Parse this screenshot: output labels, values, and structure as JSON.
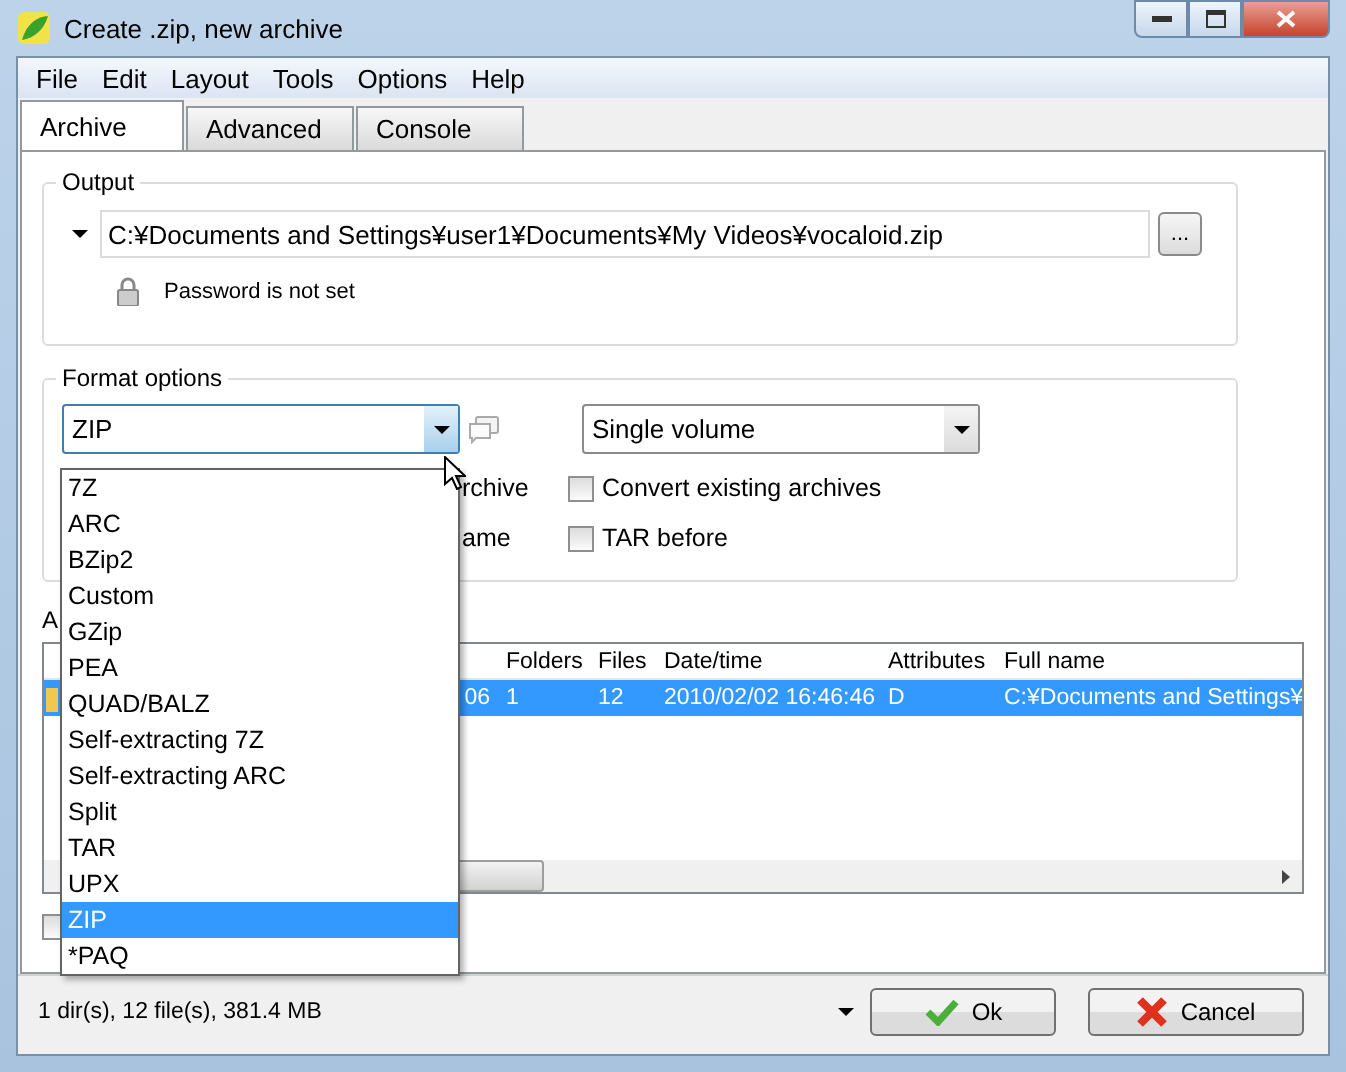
{
  "window": {
    "title": "Create .zip, new archive"
  },
  "menu": [
    "File",
    "Edit",
    "Layout",
    "Tools",
    "Options",
    "Help"
  ],
  "tabs": [
    {
      "label": "Archive",
      "selected": true
    },
    {
      "label": "Advanced",
      "selected": false
    },
    {
      "label": "Console",
      "selected": false
    }
  ],
  "output": {
    "legend": "Output",
    "path": "C:¥Documents and Settings¥user1¥Documents¥My Videos¥vocaloid.zip",
    "browse": "...",
    "password": "Password is not set"
  },
  "format_options": {
    "legend": "Format options",
    "format": {
      "value": "ZIP",
      "open": true,
      "options": [
        {
          "label": "7Z",
          "selected": false
        },
        {
          "label": "ARC",
          "selected": false
        },
        {
          "label": "BZip2",
          "selected": false
        },
        {
          "label": "Custom",
          "selected": false
        },
        {
          "label": "GZip",
          "selected": false
        },
        {
          "label": "PEA",
          "selected": false
        },
        {
          "label": "QUAD/BALZ",
          "selected": false
        },
        {
          "label": "Self-extracting 7Z",
          "selected": false
        },
        {
          "label": "Self-extracting ARC",
          "selected": false
        },
        {
          "label": "Split",
          "selected": false
        },
        {
          "label": "TAR",
          "selected": false
        },
        {
          "label": "UPX",
          "selected": false
        },
        {
          "label": "ZIP",
          "selected": true
        },
        {
          "label": "*PAQ",
          "selected": false
        }
      ]
    },
    "volume": "Single volume",
    "left_labels": [
      "rchive",
      "ame"
    ],
    "checkboxes": [
      {
        "label": "Convert existing archives",
        "checked": false
      },
      {
        "label": "TAR before",
        "checked": false
      }
    ]
  },
  "list_label": "A",
  "table": {
    "columns": [
      "Folders",
      "Files",
      "Date/time",
      "Attributes",
      "Full name"
    ],
    "rows": [
      {
        "selected": true,
        "column_1": "06",
        "cells": [
          "1",
          "12",
          "2010/02/02 16:46:46",
          "D",
          "C:¥Documents and Settings¥"
        ]
      }
    ]
  },
  "bottom_checkbox": {
    "checked": false
  },
  "status_bar": {
    "text": "1 dir(s), 12 file(s), 381.4 MB"
  },
  "buttons": [
    {
      "label": "Ok",
      "kind": "ok"
    },
    {
      "label": "Cancel",
      "kind": "cancel"
    }
  ]
}
